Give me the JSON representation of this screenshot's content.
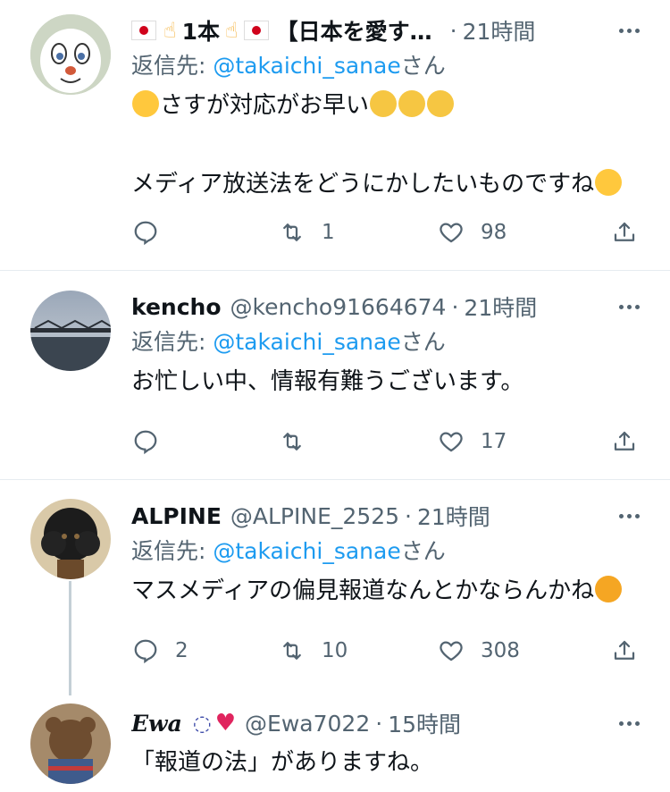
{
  "tweets": [
    {
      "name": "1本",
      "name_suffix": "【日本を愛す…",
      "handle": "",
      "time": "21時間",
      "reply_prefix": "返信先: ",
      "reply_to": "@takaichi_sanae",
      "reply_suffix": "さん",
      "lines": [
        "さすが対応がお早い",
        "",
        "メディア放送法をどうにかしたいものですね"
      ],
      "replies": "",
      "retweets": "1",
      "likes": "98"
    },
    {
      "name": "kencho",
      "handle": "@kencho91664674",
      "time": "21時間",
      "reply_prefix": "返信先: ",
      "reply_to": "@takaichi_sanae",
      "reply_suffix": "さん",
      "lines": [
        "お忙しい中、情報有難うございます。"
      ],
      "replies": "",
      "retweets": "",
      "likes": "17"
    },
    {
      "name": "ALPINE",
      "handle": "@ALPINE_2525",
      "time": "21時間",
      "reply_prefix": "返信先: ",
      "reply_to": "@takaichi_sanae",
      "reply_suffix": "さん",
      "lines": [
        "マスメディアの偏見報道なんとかならんかね"
      ],
      "replies": "2",
      "retweets": "10",
      "likes": "308"
    },
    {
      "name": "Ewa",
      "handle": "@Ewa7022",
      "time": "15時間",
      "lines": [
        "「報道の法」がありますね。"
      ]
    }
  ],
  "colors": {
    "link": "#1d9bf0",
    "muted": "#536471",
    "divider": "#e6ecf0"
  }
}
